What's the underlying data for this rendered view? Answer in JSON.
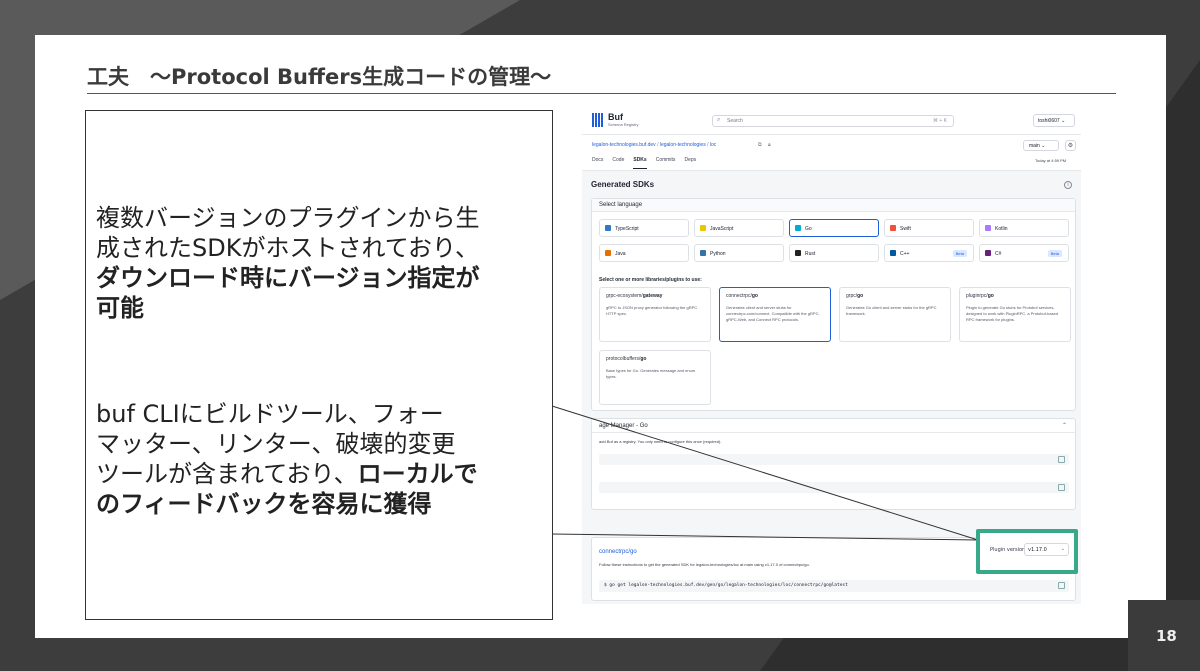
{
  "slide": {
    "title": "工夫　〜Protocol Buffers生成コードの管理〜",
    "page_number": "18"
  },
  "textbox": {
    "p1_lines": [
      {
        "text": "複数バージョンのプラグインから生",
        "bold": false
      },
      {
        "text": "成されたSDKがホストされており、",
        "bold": false
      },
      {
        "text": "ダウンロード時にバージョン指定が",
        "bold": true
      },
      {
        "text": "可能",
        "bold": true
      }
    ],
    "p2_line1": "buf CLIにビルドツール、フォー",
    "p2_line2": "マッター、リンター、破壊的変更",
    "p2_line3_normal": "ツールが含まれており、",
    "p2_line3_bold": "ローカルで",
    "p2_line4_bold": "のフィードバックを容易に獲得"
  },
  "screenshot": {
    "logo": "Buf",
    "logo_sub": "Schema Registry",
    "search_placeholder": "Search",
    "search_shortcut": "⌘ + K",
    "user": "toshi0607 ⌄",
    "breadcrumb": [
      "legalon-technologies.buf.dev",
      "legalon-technologies",
      "loc"
    ],
    "branch": "main ⌄",
    "tabs": [
      "Docs",
      "Code",
      "SDKs",
      "Commits",
      "Deps"
    ],
    "active_tab": "SDKs",
    "updated": "Today at 4:59 PM",
    "generated_title": "Generated SDKs",
    "select_language": "Select language",
    "languages": [
      {
        "name": "TypeScript",
        "color": "#3178c6",
        "beta": ""
      },
      {
        "name": "JavaScript",
        "color": "#e9c600",
        "beta": ""
      },
      {
        "name": "Go",
        "color": "#00add8",
        "beta": "",
        "selected": true
      },
      {
        "name": "Swift",
        "color": "#f05138",
        "beta": ""
      },
      {
        "name": "Kotlin",
        "color": "#a97bff",
        "beta": ""
      },
      {
        "name": "Java",
        "color": "#e76f00",
        "beta": ""
      },
      {
        "name": "Python",
        "color": "#3572a5",
        "beta": ""
      },
      {
        "name": "Rust",
        "color": "#222222",
        "beta": ""
      },
      {
        "name": "C++",
        "color": "#00599c",
        "beta": "Beta"
      },
      {
        "name": "C#",
        "color": "#68217a",
        "beta": "Beta"
      }
    ],
    "select_plugins": "Select one or more libraries/plugins to use:",
    "plugins": [
      {
        "owner": "grpc-ecosystem/",
        "name": "gateway",
        "desc": "gRPC to JSON proxy generator following the gRPC HTTP spec."
      },
      {
        "owner": "connectrpc/",
        "name": "go",
        "desc": "Generates client and server stubs for connectrpc.com/connect. Compatible with the gRPC, gRPC-Web, and Connect RPC protocols.",
        "selected": true
      },
      {
        "owner": "grpc/",
        "name": "go",
        "desc": "Generates Go client and server stubs for the gRPC framework."
      },
      {
        "owner": "pluginrpc/",
        "name": "go",
        "desc": "Plugin to generate Go stubs for Protobuf services, designed to work with PluginRPC, a Protobuf-based RPC framework for plugins."
      },
      {
        "owner": "protocolbuffers/",
        "name": "go",
        "desc": "Base types for Go. Generates message and enum types."
      }
    ],
    "pkg_manager_title": "age Manager - Go",
    "pkg_manager_text": "add Buf as a registry. You only need to configure this once (required).",
    "install_title": "connectrpc/go",
    "install_text": "Follow these instructions to get the generated SDK for legalon-technologies/loc at main using v1.17.0 of connectrpc/go.",
    "install_cmd": "$ go get legalon-technologies.buf.dev/gen/go/legalon-technologies/loc/connectrpc/go@latest",
    "plugin_version_label": "Plugin version",
    "plugin_version": "v1.17.0"
  }
}
